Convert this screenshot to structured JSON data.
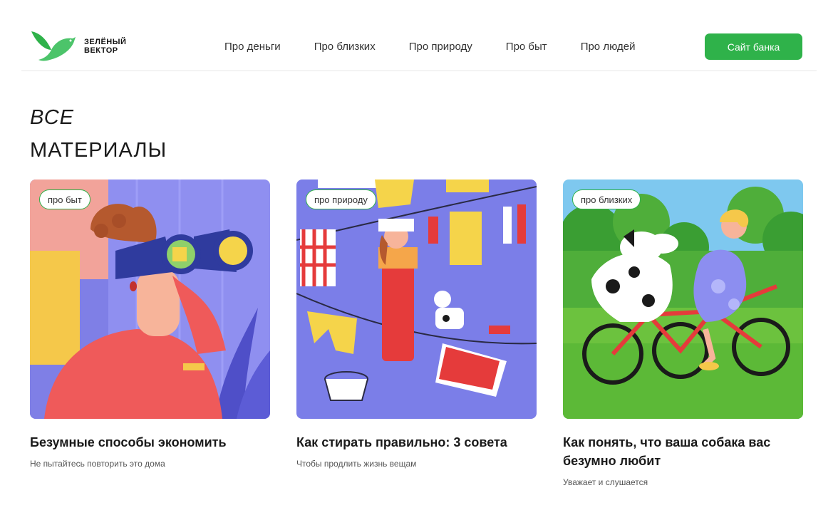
{
  "header": {
    "logo_line1": "ЗЕЛЁНЫЙ",
    "logo_line2": "ВЕКТОР",
    "nav": [
      "Про деньги",
      "Про близких",
      "Про природу",
      "Про быт",
      "Про людей"
    ],
    "bank_button": "Сайт банка"
  },
  "page": {
    "title_line1": "ВСЕ",
    "title_line2": "МАТЕРИАЛЫ"
  },
  "cards": [
    {
      "tag": "про быт",
      "title": "Безумные способы экономить",
      "subtitle": "Не пытайтесь повторить это дома"
    },
    {
      "tag": "про природу",
      "title": "Как стирать правильно: 3 совета",
      "subtitle": "Чтобы продлить жизнь вещам"
    },
    {
      "tag": "про близких",
      "title": "Как понять, что ваша собака вас безумно любит",
      "subtitle": "Уважает и слушается"
    }
  ],
  "colors": {
    "accent": "#2fb24a",
    "logo_green": "#4cc46a"
  }
}
